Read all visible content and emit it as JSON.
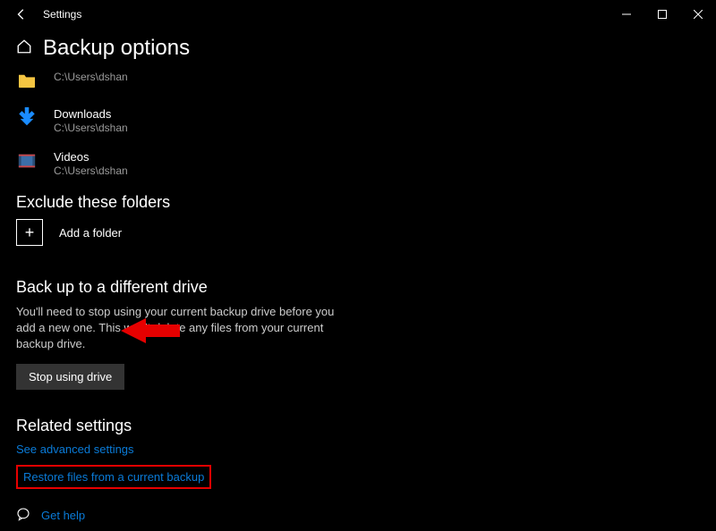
{
  "titlebar": {
    "title": "Settings"
  },
  "page": {
    "title": "Backup options"
  },
  "folders": [
    {
      "name_suffix": "",
      "path": "C:\\Users\\dshan"
    },
    {
      "name": "Downloads",
      "path": "C:\\Users\\dshan"
    },
    {
      "name": "Videos",
      "path": "C:\\Users\\dshan"
    }
  ],
  "exclude": {
    "heading": "Exclude these folders",
    "add_label": "Add a folder"
  },
  "different_drive": {
    "heading": "Back up to a different drive",
    "desc": "You'll need to stop using your current backup drive before you add a new one. This won't delete any files from your current backup drive.",
    "button": "Stop using drive"
  },
  "related": {
    "heading": "Related settings",
    "advanced": "See advanced settings",
    "restore": "Restore files from a current backup"
  },
  "help": {
    "label": "Get help"
  }
}
